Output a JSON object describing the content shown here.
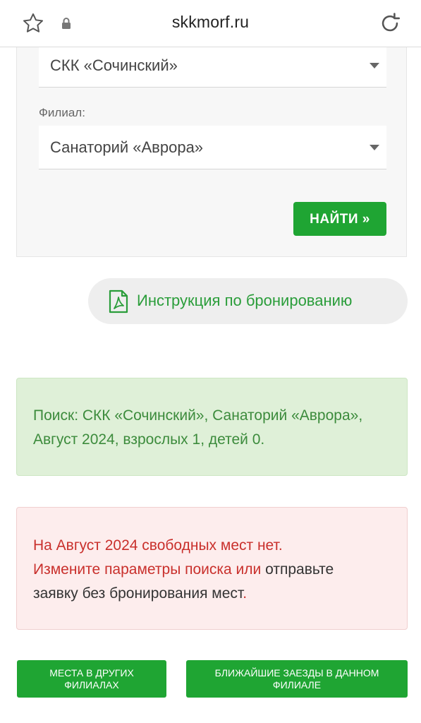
{
  "browser": {
    "url": "skkmorf.ru",
    "icons": [
      "star-icon",
      "lock-icon",
      "reload-icon"
    ]
  },
  "form": {
    "complex_value": "СКК «Сочинский»",
    "branch_label": "Филиал:",
    "branch_value": "Санаторий «Аврора»",
    "find_button": "НАЙТИ »"
  },
  "instruction": {
    "icon": "pdf-icon",
    "label": "Инструкция по бронированию"
  },
  "search_summary": "Поиск: СКК «Сочинский», Санаторий «Аврора», Август 2024, взрослых 1, детей 0.",
  "no_places": {
    "line1": "На Август 2024 свободных мест нет.",
    "change_params": "Измените параметры поиска или",
    "send_request_a": "отправьте",
    "send_request_b": "заявку без бронирования мест",
    "period": "."
  },
  "buttons": {
    "other_branches": "МЕСТА В ДРУГИХ ФИЛИАЛАХ",
    "nearest_arrivals": "БЛИЖАЙШИЕ ЗАЕЗДЫ В ДАННОМ ФИЛИАЛЕ"
  },
  "colors": {
    "accent_green": "#1fa533",
    "success_bg": "#dff0d8",
    "danger_bg": "#fdeded",
    "danger_text": "#c9302c"
  }
}
